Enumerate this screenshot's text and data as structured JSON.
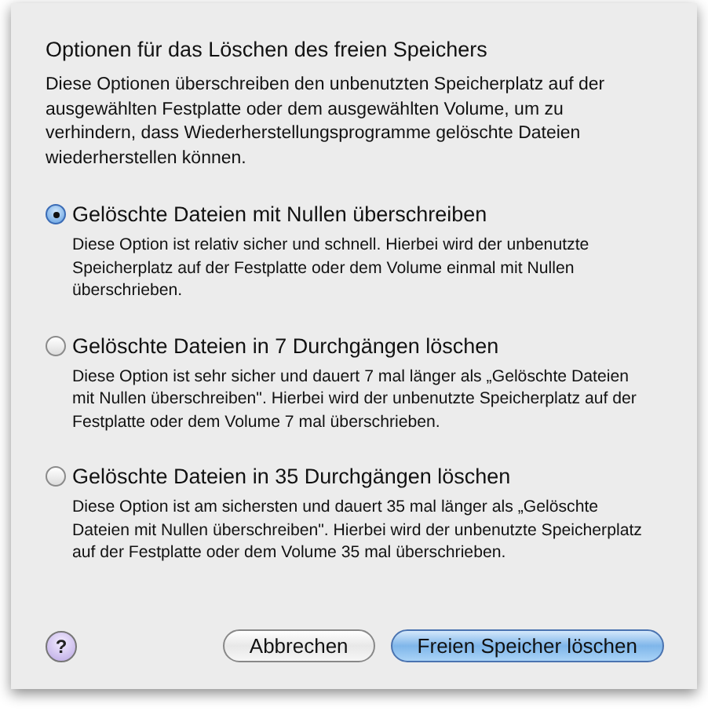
{
  "sheet": {
    "title": "Optionen für das Löschen des freien Speichers",
    "description": [
      "Diese Optionen überschreiben den unbenutzten Speicherplatz auf der",
      "ausgewählten Festplatte oder dem ausgewählten Volume, um zu",
      "verhindern, dass Wiederherstellungsprogramme gelöschte Dateien",
      "wiederherstellen können."
    ],
    "options": [
      {
        "label": "Gelöschte Dateien mit Nullen überschreiben",
        "selected": true,
        "description": [
          "Diese Option ist relativ sicher und schnell. Hierbei wird der unbenutzte",
          "Speicherplatz auf der Festplatte oder dem Volume einmal mit Nullen",
          "überschrieben."
        ]
      },
      {
        "label": "Gelöschte Dateien in 7 Durchgängen löschen",
        "selected": false,
        "description": [
          "Diese Option ist sehr sicher und dauert 7 mal länger als „Gelöschte Dateien",
          "mit Nullen überschreiben\". Hierbei wird der unbenutzte Speicherplatz auf der",
          "Festplatte oder dem Volume 7 mal überschrieben."
        ]
      },
      {
        "label": "Gelöschte Dateien in 35 Durchgängen löschen",
        "selected": false,
        "description": [
          "Diese Option ist am sichersten und dauert 35 mal länger als „Gelöschte",
          "Dateien mit Nullen überschreiben\". Hierbei wird der unbenutzte Speicherplatz",
          "auf der Festplatte oder dem Volume 35 mal überschrieben."
        ]
      }
    ],
    "help_button": "?",
    "buttons": [
      {
        "label": "Abbrechen",
        "kind": "secondary"
      },
      {
        "label": "Freien Speicher löschen",
        "kind": "default"
      }
    ]
  }
}
